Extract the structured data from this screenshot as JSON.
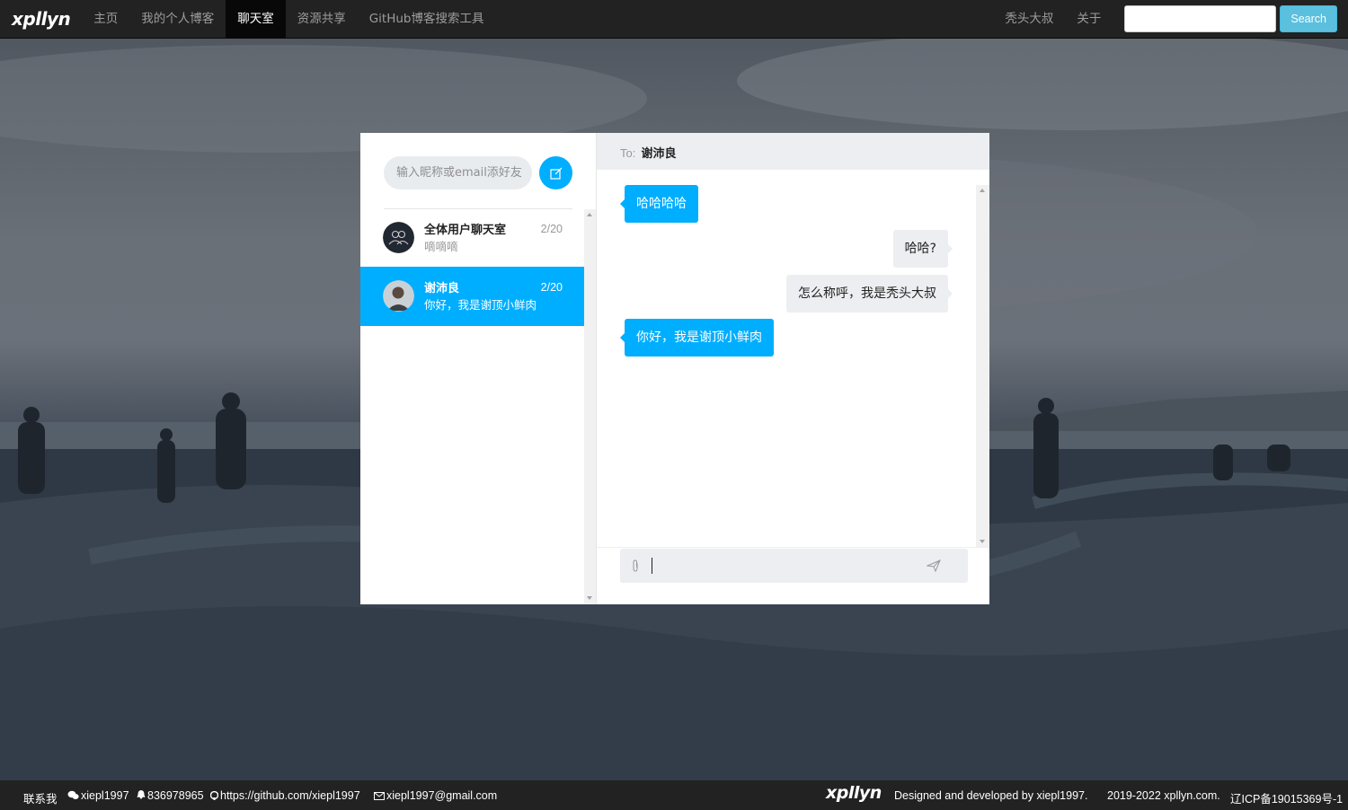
{
  "navbar": {
    "brand": "xpllyn",
    "items": [
      "主页",
      "我的个人博客",
      "聊天室",
      "资源共享",
      "GitHub博客搜索工具"
    ],
    "active_index": 2,
    "right_items": [
      "秃头大叔",
      "关于"
    ],
    "search_placeholder": "",
    "search_label": "Search"
  },
  "sidebar": {
    "add_friend_placeholder": "输入昵称或email添好友",
    "contacts": [
      {
        "name": "全体用户聊天室",
        "date": "2/20",
        "last_message": "嘀嘀嘀",
        "avatar": "group-icon",
        "selected": false
      },
      {
        "name": "谢沛良",
        "date": "2/20",
        "last_message": "你好，我是谢顶小鲜肉",
        "avatar": "user-photo",
        "selected": true
      }
    ]
  },
  "chat": {
    "to_label": "To:",
    "to_name": "谢沛良",
    "messages": [
      {
        "from": "them",
        "text": "哈哈哈哈"
      },
      {
        "from": "me",
        "text": "哈哈?"
      },
      {
        "from": "me",
        "text": "怎么称呼，我是秃头大叔"
      },
      {
        "from": "them",
        "text": "你好，我是谢顶小鲜肉"
      }
    ],
    "input_value": ""
  },
  "footer": {
    "contact_label": "联系我",
    "wechat": "xiepl1997",
    "qq": "836978965",
    "github": "https://github.com/xiepl1997",
    "email": "xiepl1997@gmail.com",
    "brand": "xpllyn",
    "designed_by": "Designed and developed by xiepl1997.",
    "copyright": "2019-2022 xpllyn.com.",
    "icp": "辽ICP备19015369号-1"
  },
  "colors": {
    "accent": "#00aeff",
    "navbar_bg": "#222222",
    "search_button": "#5bc0de",
    "bubble_me": "#eceef1"
  }
}
